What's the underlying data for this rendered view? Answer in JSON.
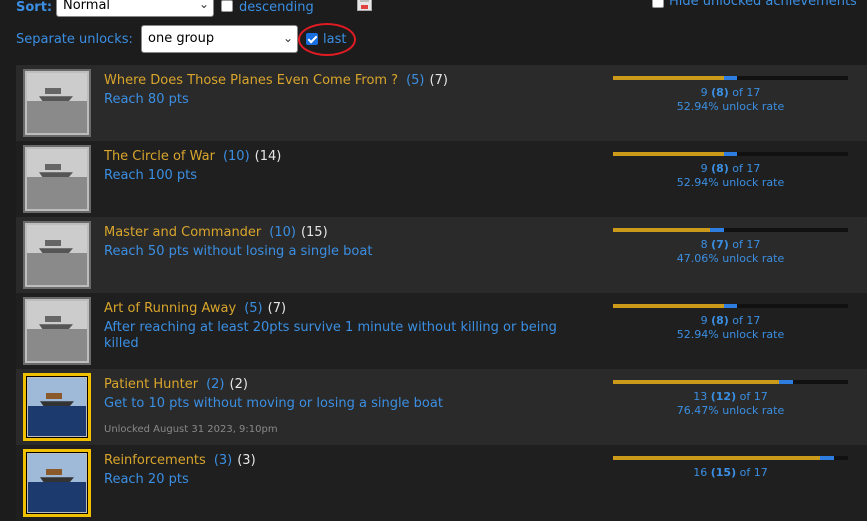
{
  "controls": {
    "sort_label": "Sort:",
    "sort_value": "Normal",
    "descending_label": "descending",
    "descending_checked": false,
    "hide_unlocked_label": "Hide unlocked achievements",
    "hide_unlocked_checked": false,
    "separate_label": "Separate unlocks:",
    "separate_value": "one group",
    "last_label": "last",
    "last_checked": true
  },
  "achievements": [
    {
      "title": "Where Does Those Planes Even Come From ?",
      "points": "(5)",
      "count": "(7)",
      "description": "Reach 80 pts",
      "unlocked": false,
      "unlocked_date": "",
      "stat_main": "9",
      "stat_paren": "(8)",
      "stat_of": "of 17",
      "rate": "52.94% unlock rate",
      "fill_pct": 52.94,
      "fill2_pct": 47.06
    },
    {
      "title": "The Circle of War",
      "points": "(10)",
      "count": "(14)",
      "description": "Reach 100 pts",
      "unlocked": false,
      "unlocked_date": "",
      "stat_main": "9",
      "stat_paren": "(8)",
      "stat_of": "of 17",
      "rate": "52.94% unlock rate",
      "fill_pct": 52.94,
      "fill2_pct": 47.06
    },
    {
      "title": "Master and Commander",
      "points": "(10)",
      "count": "(15)",
      "description": "Reach 50 pts without losing a single boat",
      "unlocked": false,
      "unlocked_date": "",
      "stat_main": "8",
      "stat_paren": "(7)",
      "stat_of": "of 17",
      "rate": "47.06% unlock rate",
      "fill_pct": 47.06,
      "fill2_pct": 41.18
    },
    {
      "title": "Art of Running Away",
      "points": "(5)",
      "count": "(7)",
      "description": "After reaching at least 20pts survive 1 minute without killing or being killed",
      "unlocked": false,
      "unlocked_date": "",
      "stat_main": "9",
      "stat_paren": "(8)",
      "stat_of": "of 17",
      "rate": "52.94% unlock rate",
      "fill_pct": 52.94,
      "fill2_pct": 47.06
    },
    {
      "title": "Patient Hunter",
      "points": "(2)",
      "count": "(2)",
      "description": "Get to 10 pts without moving or losing a single boat",
      "unlocked": true,
      "unlocked_date": "Unlocked August 31 2023, 9:10pm",
      "stat_main": "13",
      "stat_paren": "(12)",
      "stat_of": "of 17",
      "rate": "76.47% unlock rate",
      "fill_pct": 76.47,
      "fill2_pct": 70.59
    },
    {
      "title": "Reinforcements",
      "points": "(3)",
      "count": "(3)",
      "description": "Reach 20 pts",
      "unlocked": true,
      "unlocked_date": "",
      "stat_main": "16",
      "stat_paren": "(15)",
      "stat_of": "of 17",
      "rate": "",
      "fill_pct": 94.12,
      "fill2_pct": 88.24
    }
  ]
}
